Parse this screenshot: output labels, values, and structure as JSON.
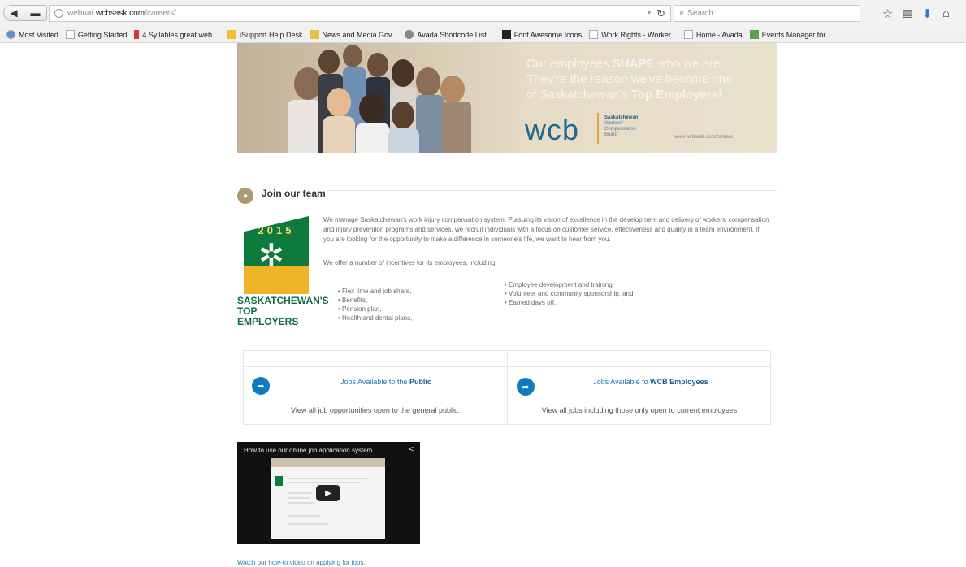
{
  "browser": {
    "url_host_prefix": "webuat.",
    "url_host": "wcbsask.com",
    "url_path": "/careers/",
    "search_placeholder": "Search",
    "bookmarks": [
      {
        "label": "Most Visited",
        "icon": "globe-icon"
      },
      {
        "label": "Getting Started",
        "icon": "page-icon"
      },
      {
        "label": "4 Syllables great web ...",
        "icon": "bottle-icon"
      },
      {
        "label": "iSupport Help Desk",
        "icon": "star-icon"
      },
      {
        "label": "News and Media  Gov...",
        "icon": "gov-icon"
      },
      {
        "label": "Avada Shortcode List ...",
        "icon": "avada-icon"
      },
      {
        "label": "Font Awesome Icons",
        "icon": "flag-icon"
      },
      {
        "label": "Work Rights - Worker...",
        "icon": "page-icon"
      },
      {
        "label": "Home - Avada",
        "icon": "page-icon"
      },
      {
        "label": "Events Manager for ...",
        "icon": "calendar-icon"
      }
    ]
  },
  "banner": {
    "line1": "Our employees ",
    "line1_bold": "SHAPE",
    "line1_end": " who we are.",
    "line2": "They're the reason we've become one",
    "line3": "of Saskatchewan's ",
    "line3_bold": "Top Employers!",
    "logo": "wcb",
    "logo_sub1": "Saskatchewan",
    "logo_sub2": "Workers'",
    "logo_sub3": "Compensation",
    "logo_sub4": "Board",
    "url": "www.wcbsask.com/careers"
  },
  "section": {
    "title": "Join our team",
    "intro": "We manage Saskatchewan's work injury compensation system. Pursuing its vision of excellence in the development and delivery of workers' compensation and injury prevention programs and services, we recruit individuals with a focus on customer service, effectiveness and quality in a team environment. If you are looking for the opportunity to make a difference in someone's life, we want to hear from you.",
    "incentives_intro": "We offer a number of incentives for its employees, including:",
    "incentives_left": [
      "Flex time and job share,",
      "Benefits,",
      "Pension plan,",
      "Health and dental plans,"
    ],
    "incentives_right": [
      "Employee development and training,",
      "Volunteer and community sponsorship, and",
      "Earned days off."
    ]
  },
  "award": {
    "year": "2015",
    "name_line1": "SASKATCHEWAN'S",
    "name_line2": "TOP EMPLOYERS"
  },
  "jobs": {
    "public_prefix": "Jobs Available to the ",
    "public_bold": "Public",
    "public_desc": "View all job opportunities open to the general public.",
    "wcb_prefix": "Jobs Available to ",
    "wcb_bold": "WCB Employees",
    "wcb_desc": "View all jobs including those only open to current employees"
  },
  "video": {
    "title": "How to use our online job application system",
    "link": "Watch our how-to video on applying for jobs."
  },
  "colors": {
    "accent": "#0f7cc0",
    "wcb_blue": "#1f6a8c",
    "award_green": "#0e7a3c",
    "award_gold": "#f0b429"
  }
}
